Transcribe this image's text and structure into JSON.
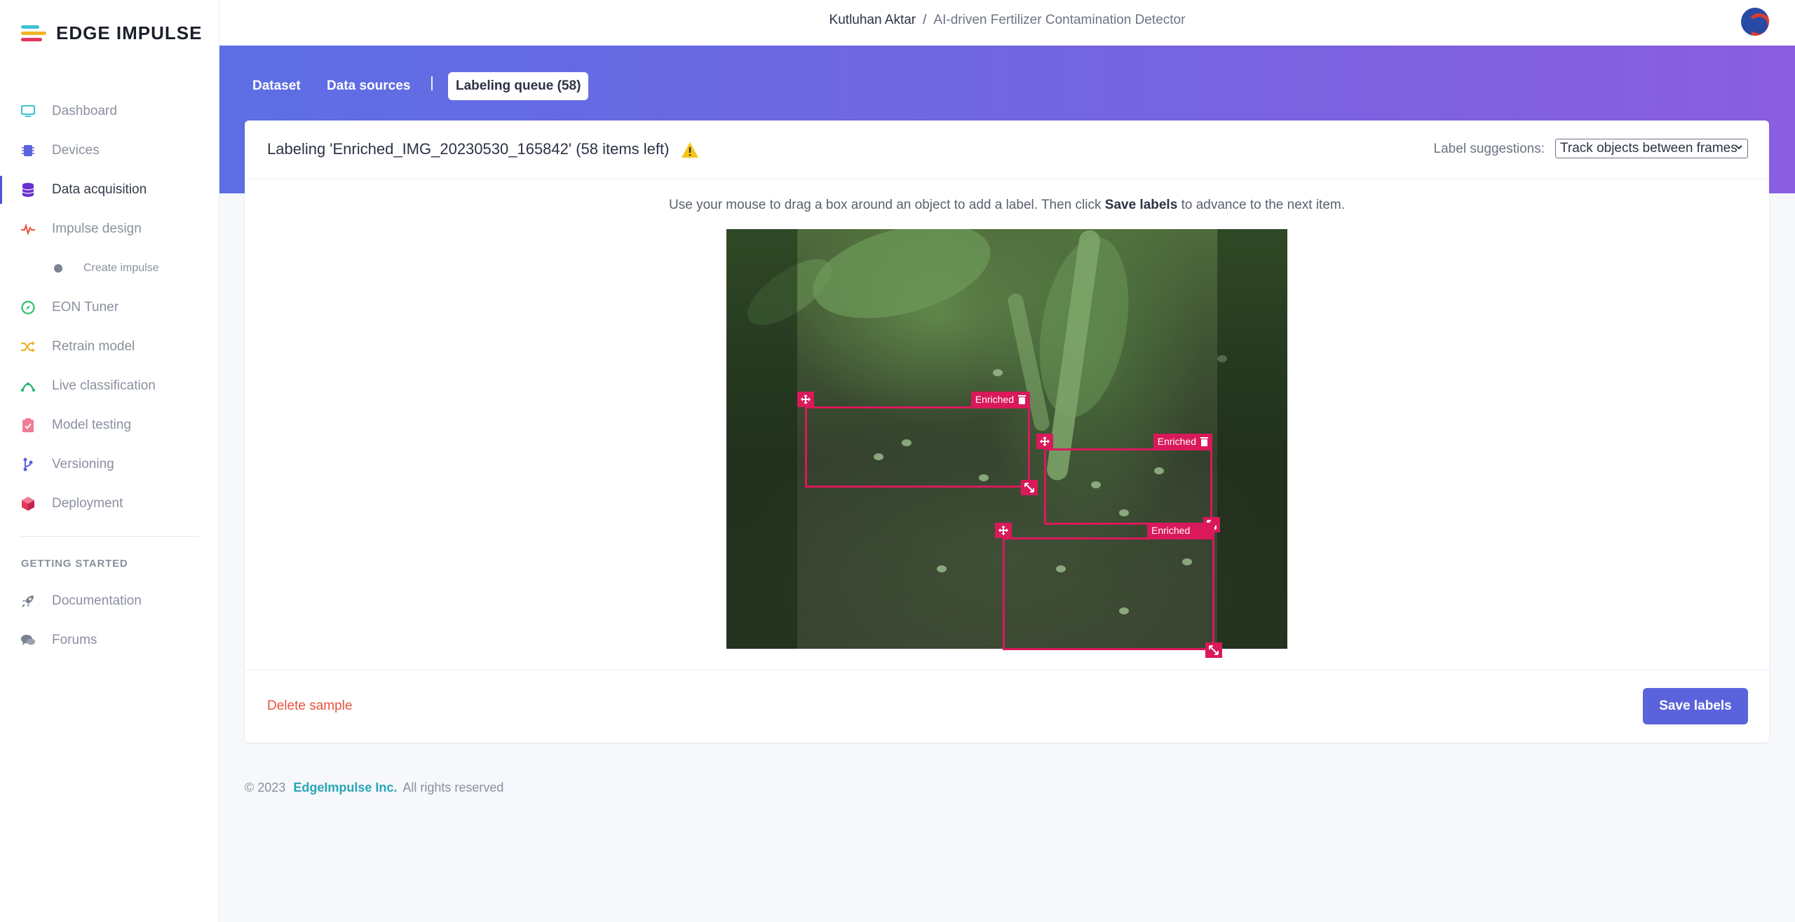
{
  "brand": {
    "name": "EDGE IMPULSE"
  },
  "sidebar": {
    "items": [
      {
        "label": "Dashboard",
        "icon": "monitor-icon",
        "color": "#3ec1d3"
      },
      {
        "label": "Devices",
        "icon": "chip-icon",
        "color": "#5a63dc"
      },
      {
        "label": "Data acquisition",
        "icon": "database-icon",
        "color": "#6a2fd0",
        "active": true
      },
      {
        "label": "Impulse design",
        "icon": "pulse-icon",
        "color": "#f0523f"
      },
      {
        "label": "Create impulse",
        "icon": "dot-icon",
        "color": "#7b8290",
        "sub": true
      },
      {
        "label": "EON Tuner",
        "icon": "compass-icon",
        "color": "#2fbf71"
      },
      {
        "label": "Retrain model",
        "icon": "shuffle-icon",
        "color": "#f0b429"
      },
      {
        "label": "Live classification",
        "icon": "signal-icon",
        "color": "#21b46a"
      },
      {
        "label": "Model testing",
        "icon": "clipboard-icon",
        "color": "#f07d95"
      },
      {
        "label": "Versioning",
        "icon": "branch-icon",
        "color": "#5a63dc"
      },
      {
        "label": "Deployment",
        "icon": "cube-icon",
        "color": "#e2385b"
      }
    ],
    "section_title": "GETTING STARTED",
    "getting_started": [
      {
        "label": "Documentation",
        "icon": "rocket-icon",
        "color": "#7b8290"
      },
      {
        "label": "Forums",
        "icon": "chat-icon",
        "color": "#7b8290"
      }
    ]
  },
  "header": {
    "user": "Kutluhan Aktar",
    "separator": "/",
    "project": "AI-driven Fertilizer Contamination Detector"
  },
  "tabs": [
    {
      "label": "Dataset"
    },
    {
      "label": "Data sources"
    },
    {
      "label": "Labeling queue (58)",
      "active": true
    }
  ],
  "labeling": {
    "title": "Labeling 'Enriched_IMG_20230530_165842' (58 items left)",
    "suggestions_label": "Label suggestions:",
    "suggestions_value": "Track objects between frames",
    "instruction_before": "Use your mouse to drag a box around an object to add a label. Then click",
    "instruction_bold": "Save labels",
    "instruction_after": "to advance to the next item.",
    "boxes": [
      {
        "label": "Enriched"
      },
      {
        "label": "Enriched"
      },
      {
        "label": "Enriched"
      }
    ],
    "delete_label": "Delete sample",
    "save_label": "Save labels"
  },
  "footer": {
    "copyright": "© 2023",
    "company": "EdgeImpulse Inc.",
    "rights": "All rights reserved"
  },
  "colors": {
    "accent": "#5a63dc",
    "bbox": "#d9195a",
    "danger": "#e5533c",
    "link": "#29a5b8"
  }
}
